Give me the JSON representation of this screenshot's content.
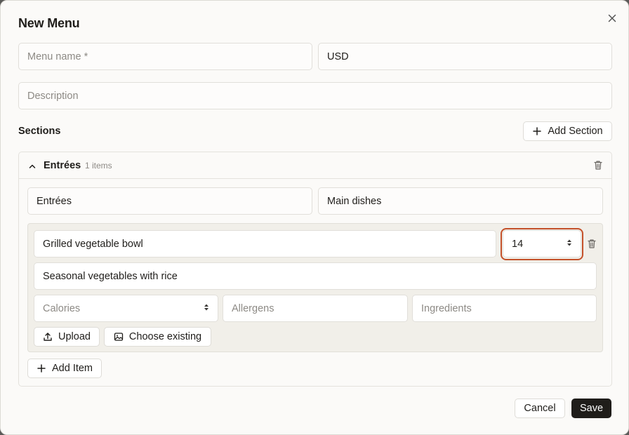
{
  "modal": {
    "title": "New Menu"
  },
  "form": {
    "menu_name_placeholder": "Menu name *",
    "currency_value": "USD",
    "description_placeholder": "Description"
  },
  "sections": {
    "label": "Sections",
    "add_section_label": "Add Section",
    "items": [
      {
        "header_name": "Entrées",
        "count_text": "1 items",
        "name_value": "Entrées",
        "subtitle_value": "Main dishes",
        "dishes": [
          {
            "name_value": "Grilled vegetable bowl",
            "price_value": "14",
            "description_value": "Seasonal vegetables with rice",
            "calories_placeholder": "Calories",
            "allergens_placeholder": "Allergens",
            "ingredients_placeholder": "Ingredients",
            "upload_label": "Upload",
            "choose_existing_label": "Choose existing"
          }
        ],
        "add_item_label": "Add Item"
      }
    ]
  },
  "footer": {
    "cancel_label": "Cancel",
    "save_label": "Save"
  },
  "colors": {
    "focus_ring": "#c4512a",
    "primary_button": "#1f1d1a"
  },
  "icons": [
    "close-icon",
    "plus-icon",
    "chevron-up-icon",
    "trash-icon",
    "upload-icon",
    "image-icon",
    "spinner-arrows-icon"
  ]
}
